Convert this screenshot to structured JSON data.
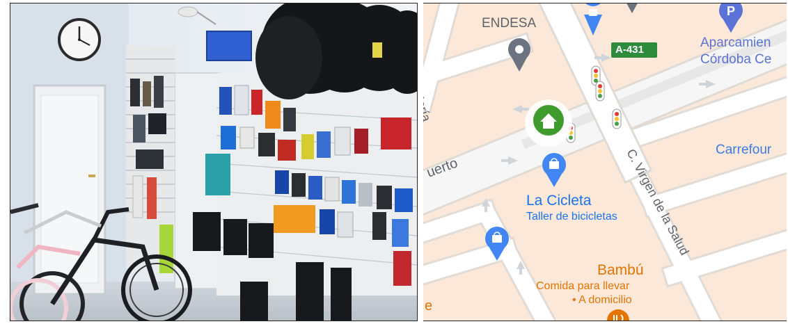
{
  "photo": {
    "subject": "bicycle-shop-interior-photo"
  },
  "map": {
    "colors": {
      "block": "#fbe8d9",
      "road": "#ffffff",
      "road_edge": "#e4ddd6",
      "major_road": "#e7e7e7",
      "poi_blue": "#4285f4",
      "poi_gray": "#6b7280",
      "poi_orange": "#e37400",
      "highway_shield": "#2e8b3d",
      "home_green": "#3f9b2e"
    },
    "labels": {
      "endesa": "ENDESA",
      "aparcamiento_1": "Aparcamien",
      "aparcamiento_2": "Córdoba Ce",
      "highway": "A-431",
      "santa_maria": "a María",
      "carrefour": "Carrefour",
      "street_left": "uerto",
      "virgen_salud": "C. Virgen de la Salud",
      "la_cicleta": "La Cicleta",
      "taller": "Taller de bicicletas",
      "bambu": "Bambú",
      "bambu_sub1": "Comida para llevar",
      "bambu_sub2": "• A domicilio",
      "edge_e": "e"
    },
    "icons": {
      "shopping_pin": "shopping-bag-pin-icon",
      "location_pin": "location-pin-icon",
      "parking_pin": "parking-pin-icon",
      "traffic_light": "traffic-light-icon",
      "home": "home-icon",
      "restaurant": "restaurant-icon",
      "arrow": "one-way-arrow-icon"
    }
  }
}
